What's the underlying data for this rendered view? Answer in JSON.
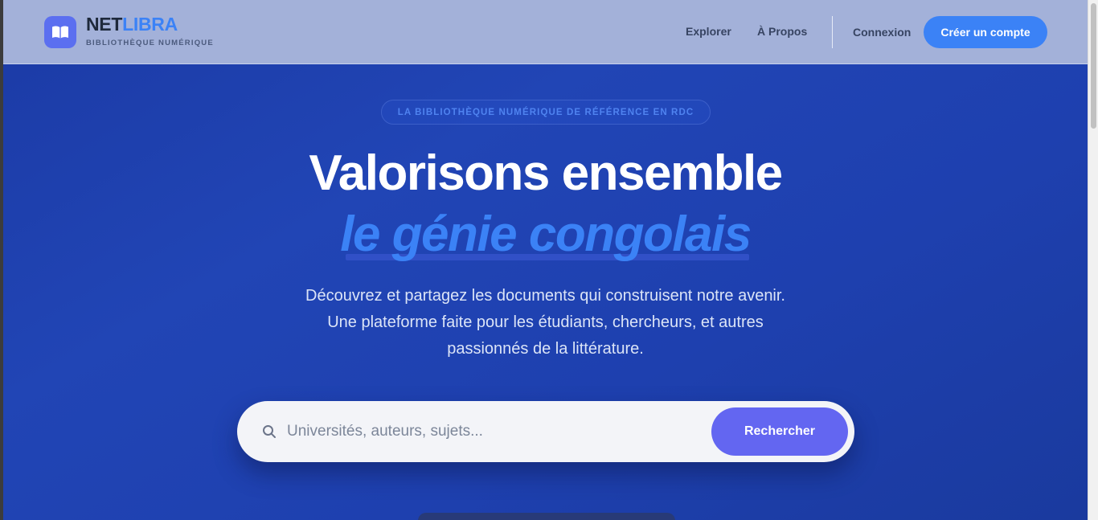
{
  "header": {
    "brand_part1": "NET",
    "brand_part2": "LIBRA",
    "tagline": "BIBLIOTHÈQUE NUMÉRIQUE",
    "logo_icon": "open-book-icon",
    "nav": {
      "explore": "Explorer",
      "about": "À Propos",
      "login": "Connexion",
      "signup": "Créer un compte"
    }
  },
  "hero": {
    "badge": "LA BIBLIOTHÈQUE NUMÉRIQUE DE RÉFÉRENCE EN RDC",
    "title_line1": "Valorisons ensemble",
    "title_line2": "le génie congolais",
    "description_line1": "Découvrez et partagez les documents qui construisent notre avenir.",
    "description_line2": "Une plateforme faite pour les étudiants, chercheurs, et autres",
    "description_line3": "passionnés de la littérature."
  },
  "search": {
    "icon": "search-icon",
    "placeholder": "Universités, auteurs, sujets...",
    "value": "",
    "button_label": "Rechercher"
  },
  "colors": {
    "accent": "#3b82f6",
    "search_button": "#6366f1",
    "logo_bg": "#5b6ff0",
    "hero_bg": "#1e40af",
    "header_bg": "#a3b1d9"
  }
}
